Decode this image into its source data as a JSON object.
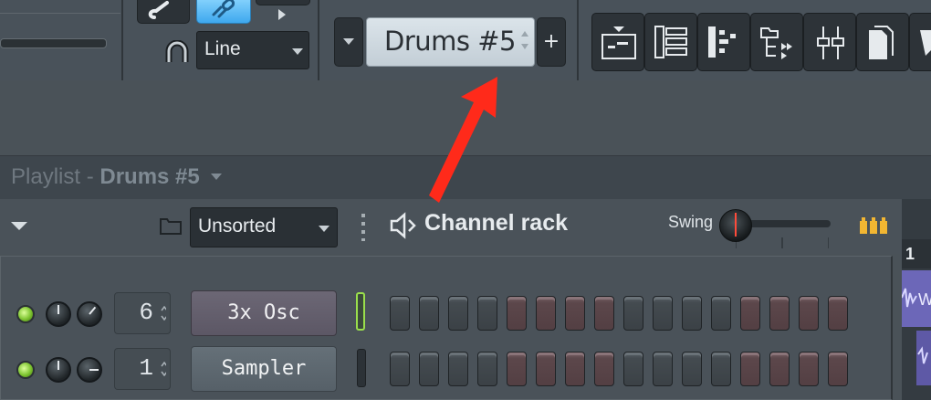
{
  "toolbar": {
    "snap_mode": "Line",
    "pattern_name": "Drums #5",
    "add_pattern_label": "+",
    "icons": [
      "playlist-icon",
      "piano-roll-icon",
      "channel-rack-icon",
      "browser-icon",
      "mixer-icon",
      "new-file-icon",
      "plugin-icon"
    ]
  },
  "playlist": {
    "title": "Playlist",
    "separator": " - ",
    "pattern": "Drums #5"
  },
  "channel_rack": {
    "group_filter": "Unsorted",
    "title": "Channel rack",
    "swing_label": "Swing",
    "channels": [
      {
        "number": "6",
        "name": "3x Osc",
        "steps_colors": "gggg rrrr gggg rrrr"
      },
      {
        "number": "1",
        "name": "Sampler",
        "steps_colors": "gggg rrrr gggg rrrr"
      }
    ]
  },
  "timeline_marker": "1",
  "colors": {
    "accent_blue": "#3ea8ee",
    "led_green": "#7cc32f",
    "arrow_red": "#ff2a1a",
    "swing_icon": "#f2b632"
  }
}
